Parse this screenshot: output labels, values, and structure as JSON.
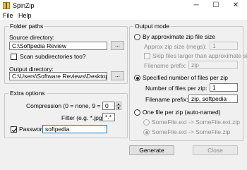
{
  "window": {
    "title": "SpinZip",
    "minimize_glyph": "─",
    "maximize_glyph": "☐",
    "close_glyph": "✕"
  },
  "menu": [
    "File",
    "Help"
  ],
  "folder_paths": {
    "title": "Folder paths",
    "source_label": "Source directory:",
    "source_value": "C:\\Softpedia Review",
    "browse_label": "...",
    "scan_subdirs_label": "Scan subdirectories too?",
    "scan_subdirs_checked": false,
    "output_label": "Output directory:",
    "output_value": "C:\\Users\\Software Reviews\\Desktop"
  },
  "extra_options": {
    "title": "Extra options",
    "compression_label": "Compression (0 = none, 9 = max):",
    "compression_value": "0",
    "filter_label": "Filter (e.g. *.jpg):",
    "filter_value": "*.*",
    "password_label": "Password:",
    "password_checked": true,
    "password_value": "softpedia"
  },
  "output_mode": {
    "title": "Output mode",
    "approx_size_label": "By approximate zip file size",
    "approx_size_selected": false,
    "approx_size_field_label": "Approx zip size (megs):",
    "approx_size_value": "1",
    "skip_larger_label": "Skip files larger than approximate size",
    "skip_larger_checked": false,
    "filename_prefix_label_1": "Filename prefix:",
    "filename_prefix_value_1": "zip",
    "specified_label": "Specified number of files per zip",
    "specified_selected": true,
    "files_per_zip_label": "Number of files per zip:",
    "files_per_zip_value": "1",
    "filename_prefix_label_2": "Filename prefix:",
    "filename_prefix_value_2": "zip, softpedia",
    "one_per_zip_label": "One file per zip (auto-named)",
    "one_per_zip_selected": false,
    "auto_opt_1": "SomeFile.ext -> SomeFile.ext.zip",
    "auto_opt_2": "SomeFile.ext -> SomeFile.zip"
  },
  "actions": {
    "generate_label": "Generate",
    "close_label": "Close"
  },
  "colors": {
    "window_bg": "#f0f0f0",
    "desktop_bg": "#6b8aa8",
    "focus_border": "#0078d7"
  }
}
